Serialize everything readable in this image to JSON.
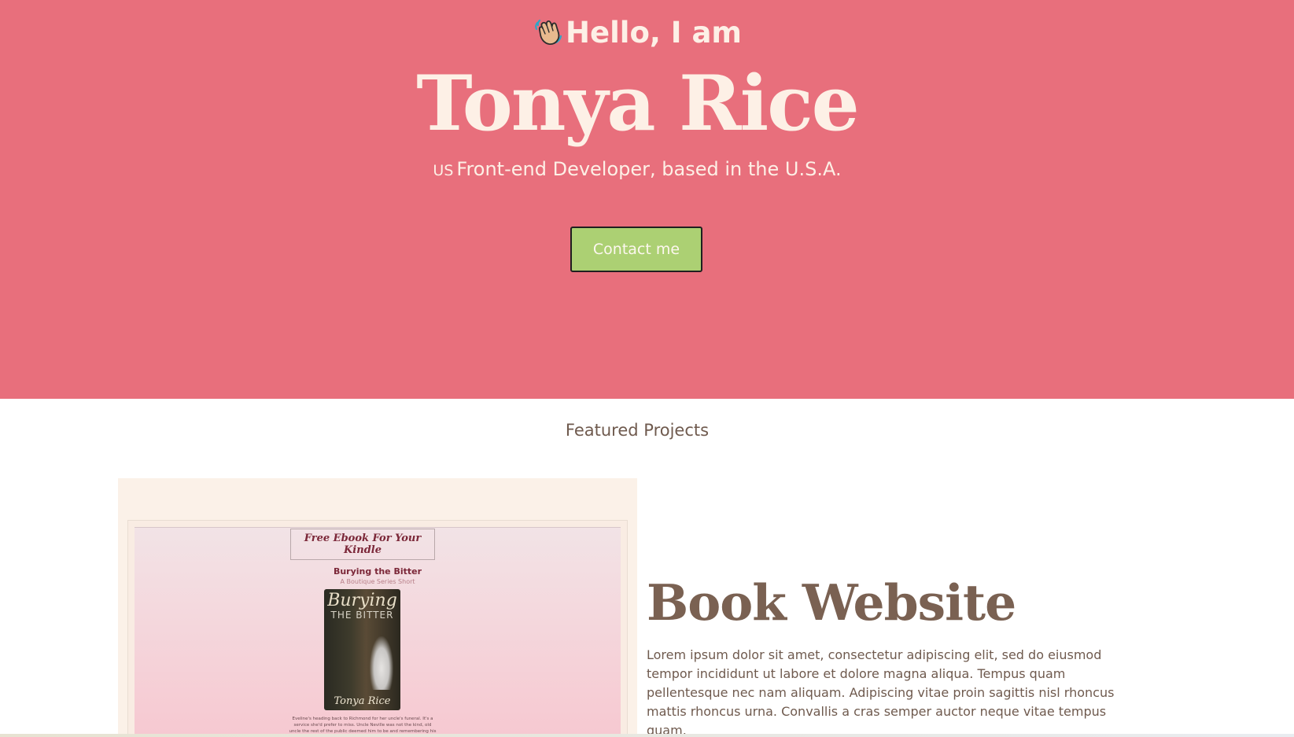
{
  "hero": {
    "greeting": "Hello, I am",
    "greeting_icon": "waving-hand-icon",
    "name": "Tonya Rice",
    "flag": "US",
    "tagline": "Front-end Developer, based in the U.S.A.",
    "contact_button": "Contact me",
    "colors": {
      "background": "#e86f7c",
      "text": "#fdf0e6",
      "button": "#acd073"
    }
  },
  "projects": {
    "heading": "Featured Projects",
    "items": [
      {
        "title": "Book Website",
        "description": "Lorem ipsum dolor sit amet, consectetur adipiscing elit, sed do eiusmod tempor incididunt ut labore et dolore magna aliqua. Tempus quam pellentesque nec nam aliquam. Adipiscing vitae proin sagittis nisl rhoncus mattis rhoncus urna. Convallis a cras semper auctor neque vitae tempus quam.",
        "screenshot": {
          "banner": "Free Ebook For Your Kindle",
          "book_title": "Burying the Bitter",
          "book_subtitle": "A Boutique Series Short",
          "cover_title_line1": "Burying",
          "cover_title_line2": "THE BITTER",
          "cover_author": "Tonya Rice",
          "blurb": "Eveline's heading back to Richmond for her uncle's funeral. It's a service she'd prefer to miss. Uncle Neville was not the kind, old uncle the rest of the public deemed him to be and remembering his"
        }
      }
    ]
  }
}
